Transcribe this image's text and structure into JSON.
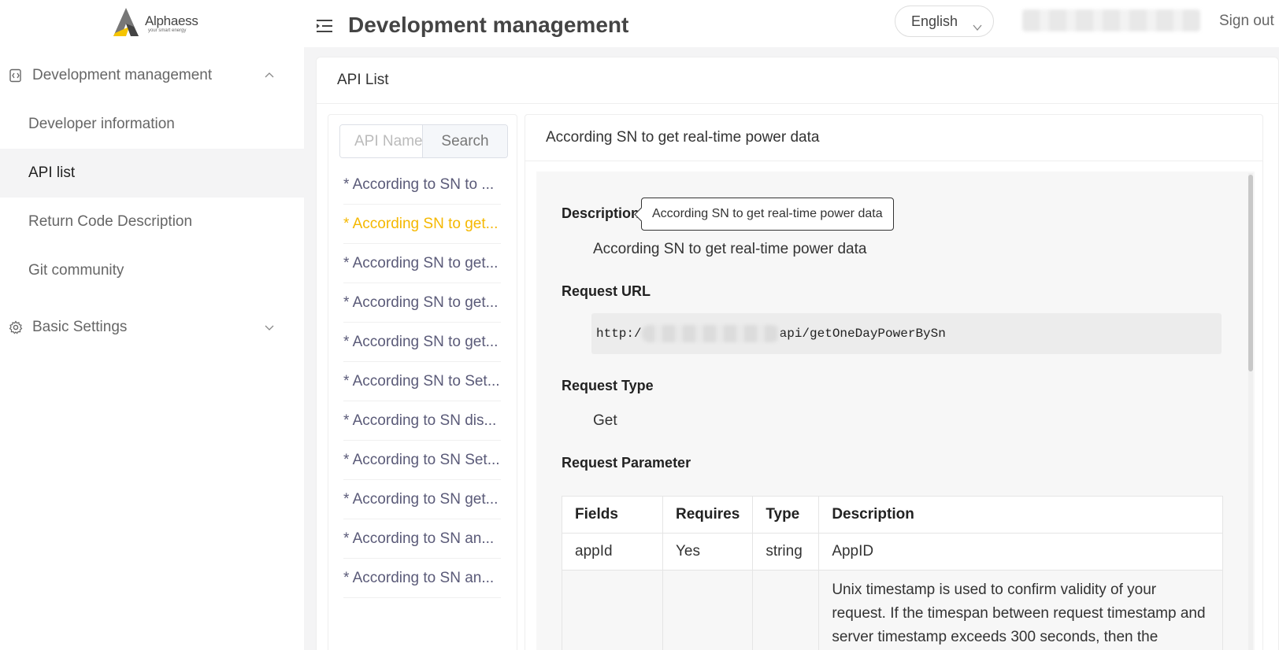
{
  "logo": {
    "name": "Alphaess",
    "tagline": "your smart energy"
  },
  "header": {
    "title": "Development management",
    "language": "English",
    "sign_out": "Sign out"
  },
  "sidebar": {
    "groups": [
      {
        "label": "Development management",
        "icon": "code-file-icon",
        "expanded": true
      },
      {
        "label": "Basic Settings",
        "icon": "gear-icon",
        "expanded": false
      }
    ],
    "items": [
      {
        "label": "Developer information"
      },
      {
        "label": "API list"
      },
      {
        "label": "Return Code Description"
      },
      {
        "label": "Git community"
      }
    ]
  },
  "card": {
    "title": "API List"
  },
  "search": {
    "placeholder": "API Name",
    "button": "Search"
  },
  "api_list": [
    "* According to SN to ...",
    "* According SN to get...",
    "* According SN to get...",
    "* According SN to get...",
    "* According SN to get...",
    "* According SN to Set...",
    "* According to SN dis...",
    "* According to SN Set...",
    "* According to SN get...",
    "* According to SN an...",
    "* According to SN an..."
  ],
  "detail": {
    "title": "According SN to get real-time power data",
    "description_label": "Description",
    "tooltip": "According SN to get real-time power data",
    "description": "According SN to get real-time power data",
    "request_url_label": "Request URL",
    "url_prefix": "http:/",
    "url_suffix": "api/getOneDayPowerBySn",
    "request_type_label": "Request Type",
    "request_type": "Get",
    "request_parameter_label": "Request Parameter",
    "table": {
      "headers": [
        "Fields",
        "Requires",
        "Type",
        "Description"
      ],
      "rows": [
        [
          "appId",
          "Yes",
          "string",
          "AppID"
        ],
        [
          "",
          "",
          "",
          "Unix timestamp is used to confirm validity of your request. If the timespan between request timestamp and server timestamp exceeds 300 seconds, then the"
        ]
      ]
    }
  }
}
